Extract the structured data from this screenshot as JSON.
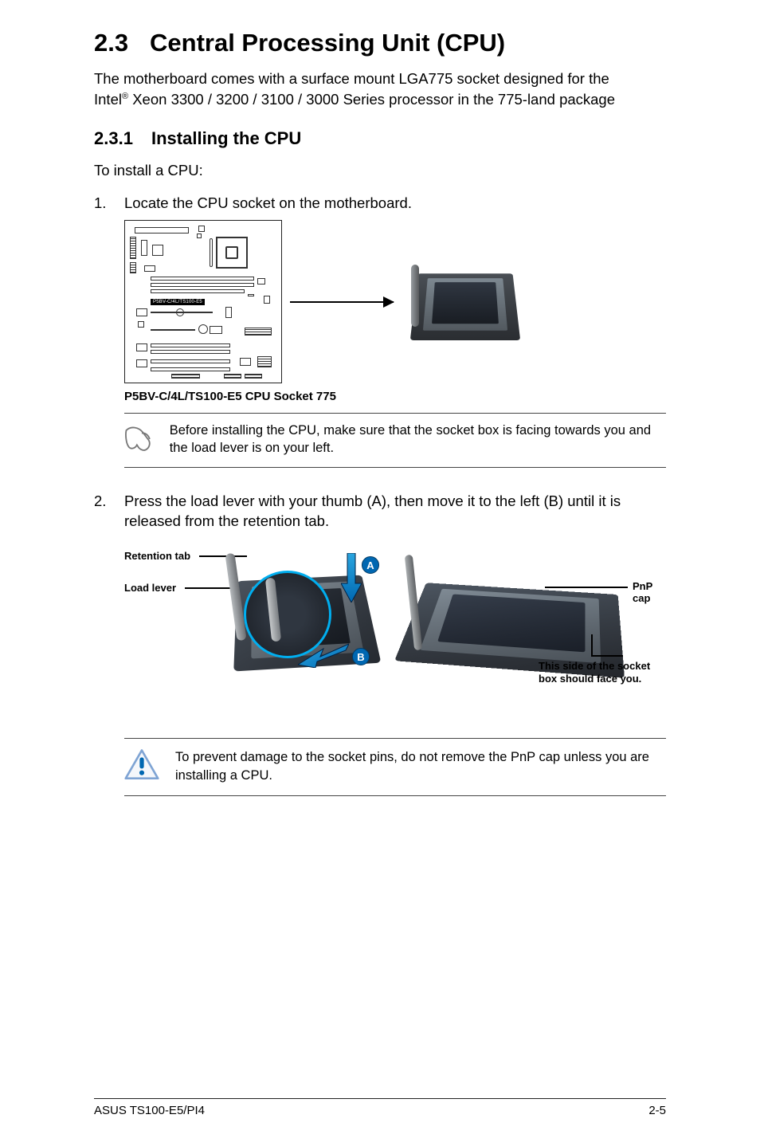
{
  "heading": {
    "num": "2.3",
    "title": "Central Processing Unit (CPU)"
  },
  "intro": {
    "line1": "The motherboard comes with a surface mount LGA775 socket designed for the",
    "line2a": "Intel",
    "sup": "®",
    "line2b": " Xeon 3300 / 3200 / 3100 / 3000 Series processor in the 775-land package"
  },
  "sub": {
    "num": "2.3.1",
    "title": "Installing the CPU"
  },
  "lead": "To install a CPU:",
  "step1": {
    "num": "1.",
    "text": "Locate the CPU socket on the motherboard."
  },
  "diag_label": "P5BV-C/4L/TS100-E5",
  "fig_caption": "P5BV-C/4L/TS100-E5 CPU Socket 775",
  "note1": "Before installing the CPU, make sure that the socket box is facing towards you and the load lever is on your left.",
  "step2": {
    "num": "2.",
    "text": "Press the load lever with your thumb (A), then move it to the left (B) until it is released from the retention tab."
  },
  "labels": {
    "retention": "Retention tab",
    "loadlever": "Load lever",
    "pnp": "PnP cap",
    "faceyou1": "This side of the socket",
    "faceyou2": "box should face you."
  },
  "bubbles": {
    "a": "A",
    "b": "B"
  },
  "note2": "To prevent damage to the socket pins, do not remove the PnP cap unless you are installing a CPU.",
  "footer": {
    "left": "ASUS TS100-E5/PI4",
    "right": "2-5"
  }
}
